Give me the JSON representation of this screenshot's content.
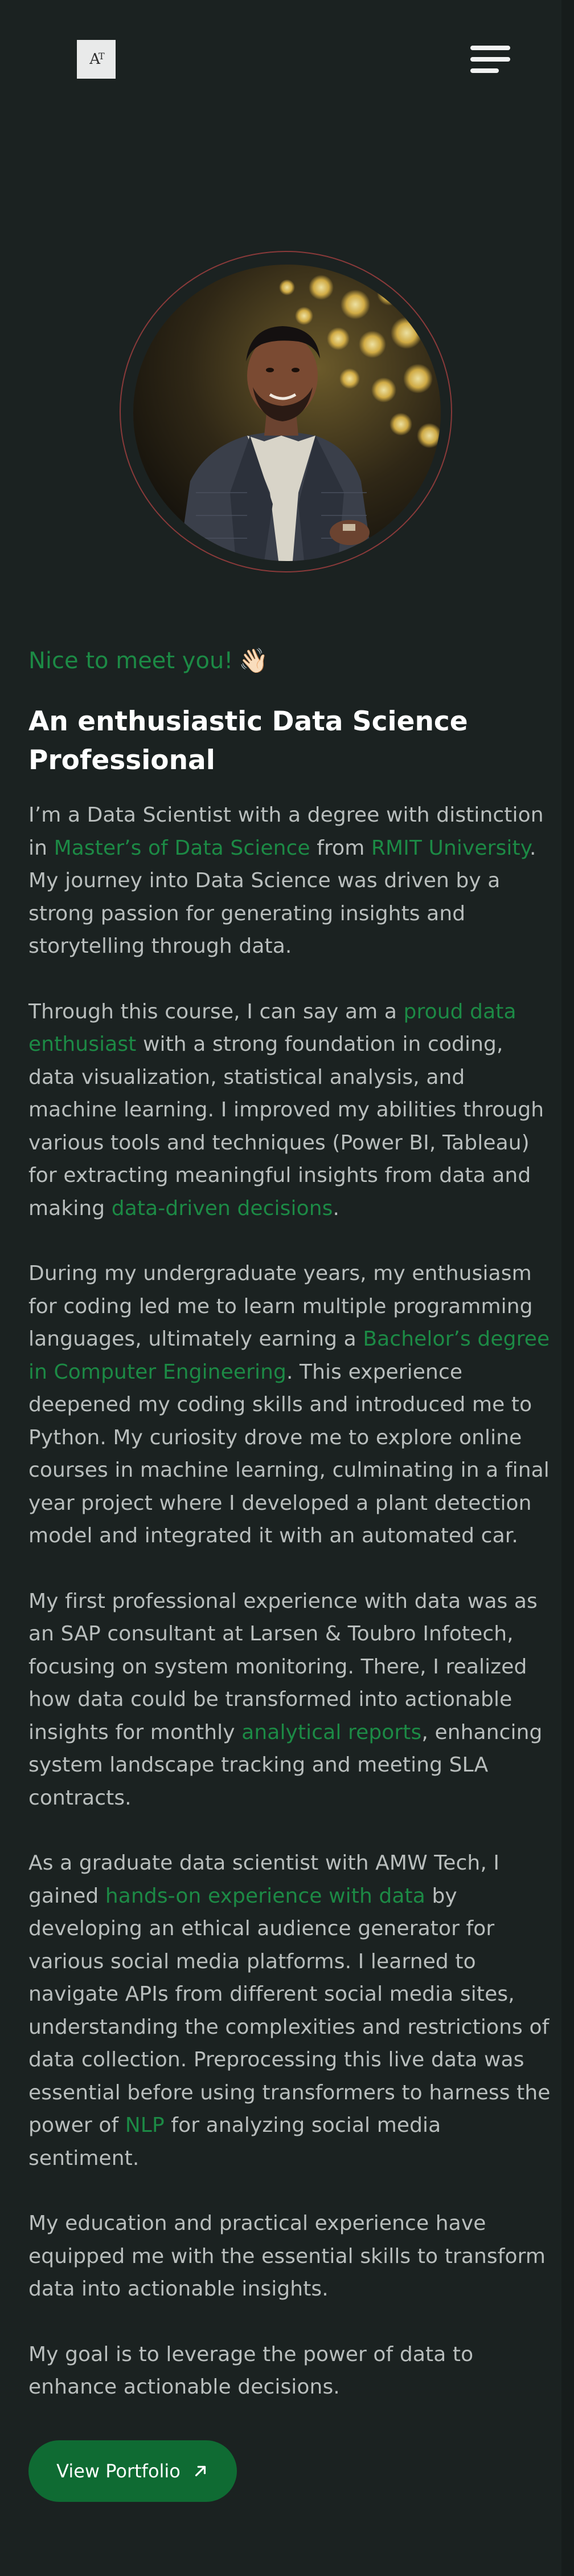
{
  "header": {
    "logo_text": "A",
    "logo_sup": "T",
    "menu_icon": "hamburger-menu-icon"
  },
  "profile": {
    "avatar_icon": "profile-photo"
  },
  "intro": {
    "greeting": "Nice to meet you!",
    "wave": "👋🏻",
    "headline": "An enthusiastic Data Science Professional"
  },
  "bio": {
    "p1": {
      "t1": "I’m a Data Scientist with a degree with distinction in ",
      "h1": "Master’s of Data Science",
      "t2": " from ",
      "h2": "RMIT University",
      "t3": ". My journey into Data Science was driven by a strong passion for generating insights and storytelling through data."
    },
    "p2": {
      "t1": "Through this course, I can say am a ",
      "h1": "proud data enthusiast",
      "t2": " with a strong foundation in coding, data visualization, statistical analysis, and machine learning. I improved my abilities through various tools and techniques (Power BI, Tableau) for extracting meaningful insights from data and making ",
      "h2": "data-driven decisions",
      "t3": "."
    },
    "p3": {
      "t1": "During my undergraduate years, my enthusiasm for coding led me to learn multiple programming languages, ultimately earning a ",
      "h1": "Bachelor’s degree in Computer Engineering",
      "t2": ". This experience deepened my coding skills and introduced me to Python. My curiosity drove me to explore online courses in machine learning, culminating in a final year project where I developed a plant detection model and integrated it with an automated car."
    },
    "p4": {
      "t1": "My first professional experience with data was as an SAP consultant at Larsen & Toubro Infotech, focusing on system monitoring. There, I realized how data could be transformed into actionable insights for monthly ",
      "h1": "analytical reports",
      "t2": ", enhancing system landscape tracking and meeting SLA contracts."
    },
    "p5": {
      "t1": "As a graduate data scientist with AMW Tech, I gained ",
      "h1": "hands-on experience with data",
      "t2": " by developing an ethical audience generator for various social media platforms. I learned to navigate APIs from different social media sites, understanding the complexities and restrictions of data collection. Preprocessing this live data was essential before using transformers to harness the power of ",
      "h2": "NLP",
      "t3": " for analyzing social media sentiment."
    },
    "p6": "My education and practical experience have equipped me with the essential skills to transform data into actionable insights.",
    "p7": "My goal is to leverage the power of data to enhance actionable decisions."
  },
  "cta": {
    "label": "View Portfolio",
    "icon": "arrow-up-right-icon"
  },
  "colors": {
    "background": "#1b2221",
    "accent": "#1c8a45",
    "button": "#0f6b33",
    "text": "#b9bebd",
    "heading": "#ffffff"
  }
}
